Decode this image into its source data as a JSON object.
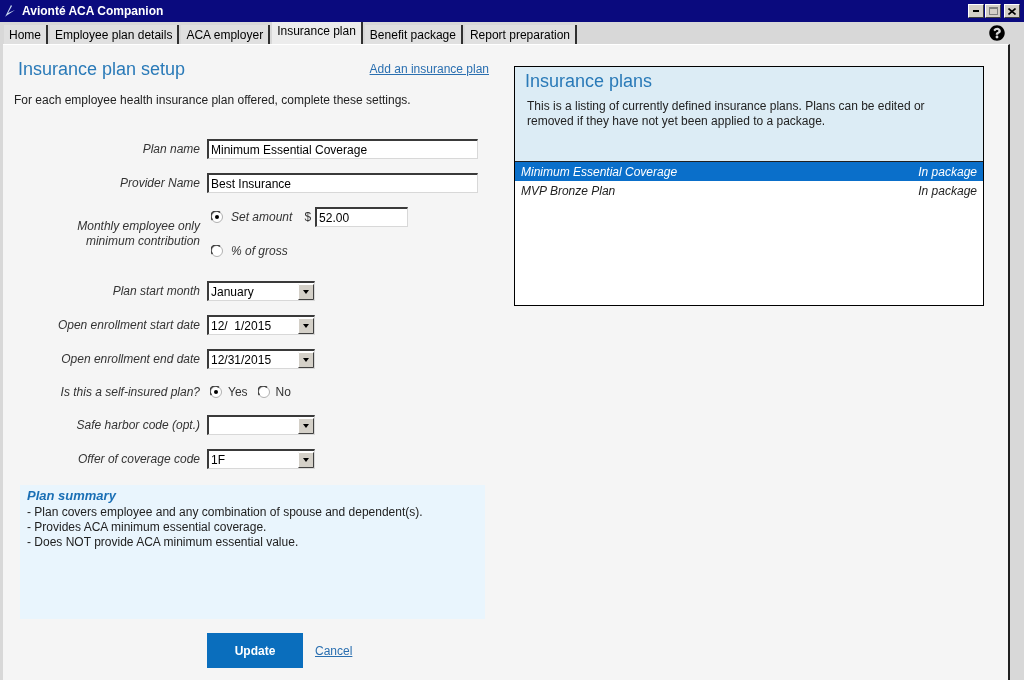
{
  "window": {
    "title": "Avionté ACA Companion"
  },
  "tabs": [
    {
      "label": "Home",
      "selected": false
    },
    {
      "label": "Employee plan details",
      "selected": false
    },
    {
      "label": "ACA employer",
      "selected": false
    },
    {
      "label": "Insurance plan",
      "selected": true
    },
    {
      "label": "Benefit package",
      "selected": false
    },
    {
      "label": "Report preparation",
      "selected": false
    }
  ],
  "setup": {
    "title": "Insurance plan setup",
    "add_link": "Add an insurance plan",
    "intro": "For each employee health insurance plan offered, complete these settings.",
    "fields": [
      {
        "kind": "text",
        "label": "Plan name",
        "value": "Minimum Essential Coverage"
      },
      {
        "kind": "text",
        "label": "Provider Name",
        "value": "Best Insurance"
      },
      {
        "kind": "contribution",
        "label": "Monthly employee only minimum contribution",
        "options": [
          {
            "label": "Set amount",
            "selected": true,
            "currency": "$",
            "value": "52.00"
          },
          {
            "label": "% of gross",
            "selected": false
          }
        ]
      },
      {
        "kind": "select",
        "label": "Plan start month",
        "value": "January"
      },
      {
        "kind": "select",
        "label": "Open enrollment start date",
        "value": "12/  1/2015"
      },
      {
        "kind": "select",
        "label": "Open enrollment end date",
        "value": "12/31/2015"
      },
      {
        "kind": "radio",
        "label": "Is this a self-insured plan?",
        "options": [
          {
            "label": "Yes",
            "selected": true
          },
          {
            "label": "No",
            "selected": false
          }
        ]
      },
      {
        "kind": "select",
        "label": "Safe harbor code (opt.)"
      },
      {
        "kind": "select",
        "label": "Offer of coverage code",
        "value": "1F"
      }
    ]
  },
  "summary": {
    "title": "Plan summary",
    "lines": [
      "- Plan covers employee and any combination of spouse and dependent(s).",
      "- Provides ACA minimum essential coverage.",
      "- Does NOT provide ACA minimum essential value."
    ]
  },
  "actions": {
    "update": "Update",
    "cancel": "Cancel"
  },
  "plans_panel": {
    "title": "Insurance plans",
    "description": "This is a listing of currently defined insurance plans. Plans can be edited or removed if they have not yet been applied to a package.",
    "plans": [
      {
        "name": "Minimum Essential Coverage",
        "status": "In package",
        "selected": true
      },
      {
        "name": "MVP Bronze Plan",
        "status": "In package",
        "selected": false
      }
    ]
  }
}
